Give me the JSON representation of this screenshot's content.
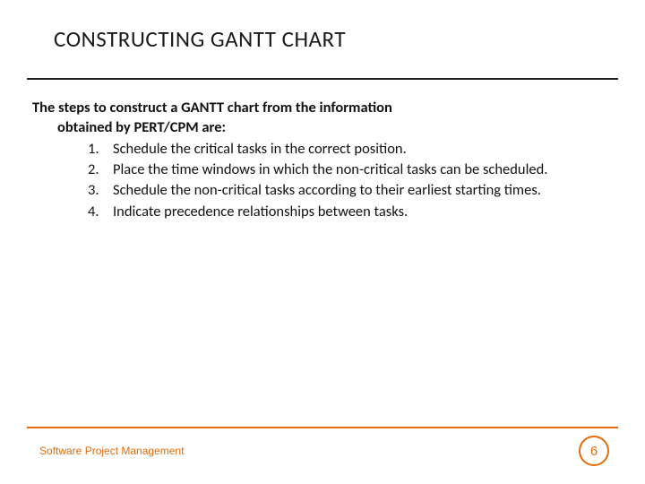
{
  "title": "CONSTRUCTING GANTT CHART",
  "intro": {
    "line1": "The steps to construct a GANTT chart from the information",
    "line2": "obtained by PERT/CPM are:"
  },
  "steps": [
    {
      "num": "1.",
      "text": "Schedule the critical tasks in the correct position."
    },
    {
      "num": "2.",
      "text": "Place the time windows in which the non-critical tasks can be scheduled."
    },
    {
      "num": "3.",
      "text": "Schedule the non-critical tasks according to their earliest starting times."
    },
    {
      "num": "4.",
      "text": "Indicate precedence relationships between tasks."
    }
  ],
  "footer": {
    "text": "Software Project Management",
    "page": "6"
  }
}
